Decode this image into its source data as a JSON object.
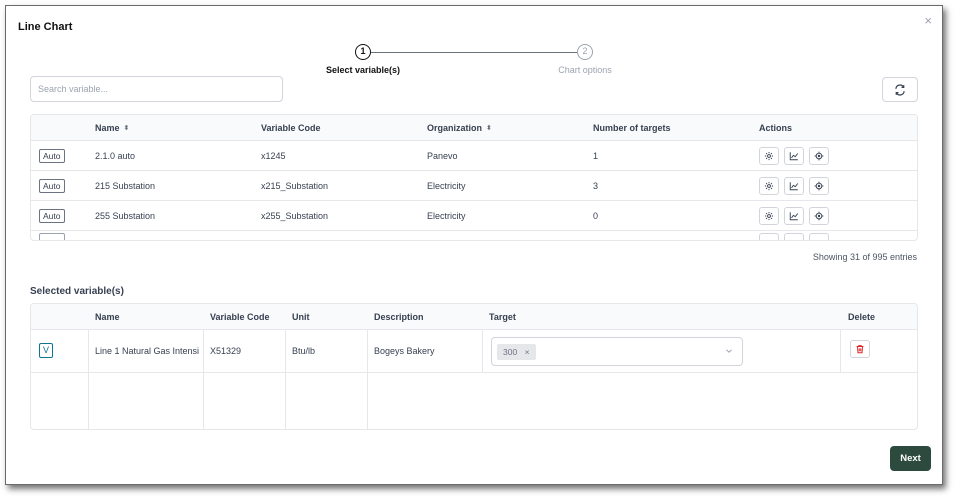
{
  "modal": {
    "title": "Line Chart",
    "close_glyph": "×"
  },
  "stepper": [
    {
      "number": "1",
      "label": "Select variable(s)",
      "active": true
    },
    {
      "number": "2",
      "label": "Chart options",
      "active": false
    }
  ],
  "search": {
    "placeholder": "Search variable..."
  },
  "icons": {
    "refresh": "refresh-icon",
    "settings": "gear-icon",
    "chart": "line-chart-icon",
    "target": "target-icon",
    "delete": "trash-icon",
    "sort": "sort-icon",
    "chevron": "chevron-down-icon"
  },
  "variables_table": {
    "columns": [
      "Name",
      "Variable Code",
      "Organization",
      "Number of targets",
      "Actions"
    ],
    "rows": [
      {
        "tag": "Auto",
        "name": "2.1.0 auto",
        "code": "x1245",
        "organization": "Panevo",
        "targets": "1"
      },
      {
        "tag": "Auto",
        "name": "215 Substation",
        "code": "x215_Substation",
        "organization": "Electricity",
        "targets": "3"
      },
      {
        "tag": "Auto",
        "name": "255 Substation",
        "code": "x255_Substation",
        "organization": "Electricity",
        "targets": "0"
      }
    ],
    "entries_text": "Showing 31 of 995 entries"
  },
  "selected": {
    "title": "Selected variable(s)",
    "columns": [
      "Name",
      "Variable Code",
      "Unit",
      "Description",
      "Target",
      "Delete"
    ],
    "rows": [
      {
        "tag": "V",
        "name": "Line 1 Natural Gas Intensi",
        "code": "X51329",
        "unit": "Btu/lb",
        "description": "Bogeys Bakery",
        "target_chip": "300",
        "chip_close": "×"
      }
    ]
  },
  "footer": {
    "next_label": "Next"
  },
  "colors": {
    "primary": "#2d4a3e",
    "delete": "#dc2626",
    "v_tag": "#0e7490"
  }
}
